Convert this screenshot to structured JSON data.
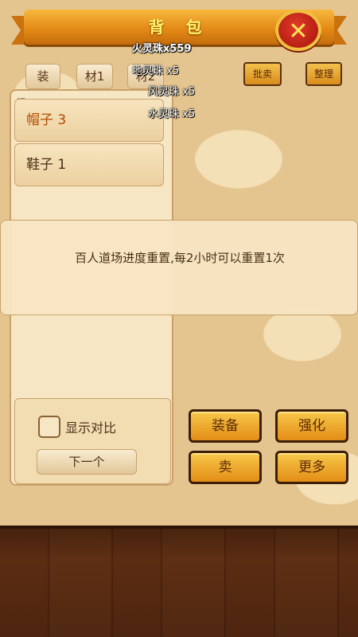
{
  "header": {
    "title": "背 包",
    "close_icon": "close-icon"
  },
  "tabs": [
    {
      "label": "装"
    },
    {
      "label": "材1"
    },
    {
      "label": "材2"
    }
  ],
  "toolbar": {
    "batch_sell_label": "批卖",
    "sort_label": "整理"
  },
  "drops": [
    "火灵珠x559",
    "地灵珠 x5",
    "风灵珠 x5",
    "水灵珠 x5"
  ],
  "list": {
    "header_fragment": "经",
    "items": [
      {
        "label": "帽子 3",
        "selected": true
      },
      {
        "label": "鞋子 1",
        "selected": false
      }
    ]
  },
  "notice": {
    "text": "百人道场进度重置,每2小时可以重置1次"
  },
  "compare": {
    "label": "显示对比",
    "checked": false
  },
  "next_label": "下一个",
  "actions": {
    "equip": "装备",
    "enhance": "强化",
    "sell": "卖",
    "more": "更多"
  }
}
